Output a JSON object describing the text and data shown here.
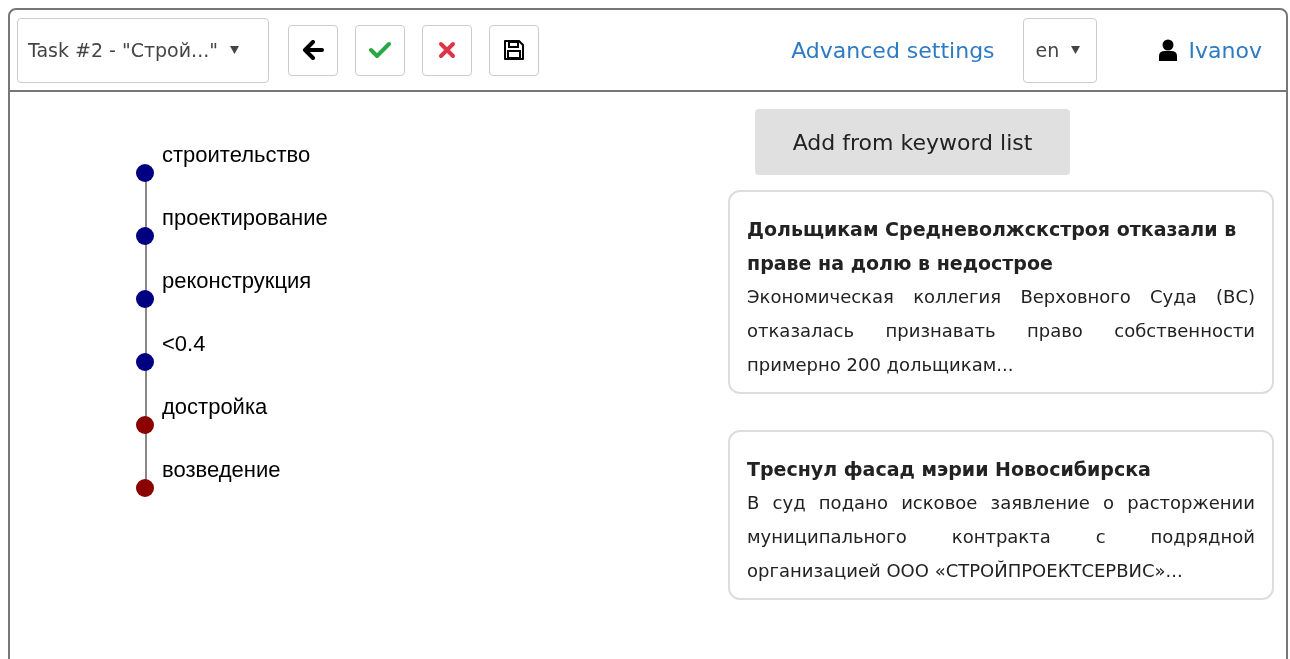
{
  "toolbar": {
    "task_select": "Task #2 - \"Строй...\"",
    "buttons": [
      {
        "kind": "back"
      },
      {
        "kind": "accept"
      },
      {
        "kind": "reject"
      },
      {
        "kind": "save"
      }
    ],
    "advanced_settings": "Advanced settings",
    "language": "en",
    "user": "Ivanov"
  },
  "keyword_chain": [
    {
      "label": "строительство",
      "color": "#000080"
    },
    {
      "label": "проектирование",
      "color": "#000080"
    },
    {
      "label": "реконструкция",
      "color": "#000080"
    },
    {
      "label": "<0.4",
      "color": "#000080"
    },
    {
      "label": "достройка",
      "color": "#8b0000"
    },
    {
      "label": "возведение",
      "color": "#8b0000"
    }
  ],
  "add_button": "Add from keyword list",
  "articles": [
    {
      "title": "Дольщикам Средневолжскстроя отказали в праве на долю в недострое",
      "text": "Экономическая коллегия Верховного Суда (ВС) отказалась признавать право собственности примерно 200 дольщикам..."
    },
    {
      "title": "Треснул фасад мэрии Новосибирска",
      "text": "В суд подано исковое заявление о расторжении муниципального контракта с подрядной организацией ООО «СТРОЙПРОЕКТСЕРВИС»..."
    }
  ]
}
